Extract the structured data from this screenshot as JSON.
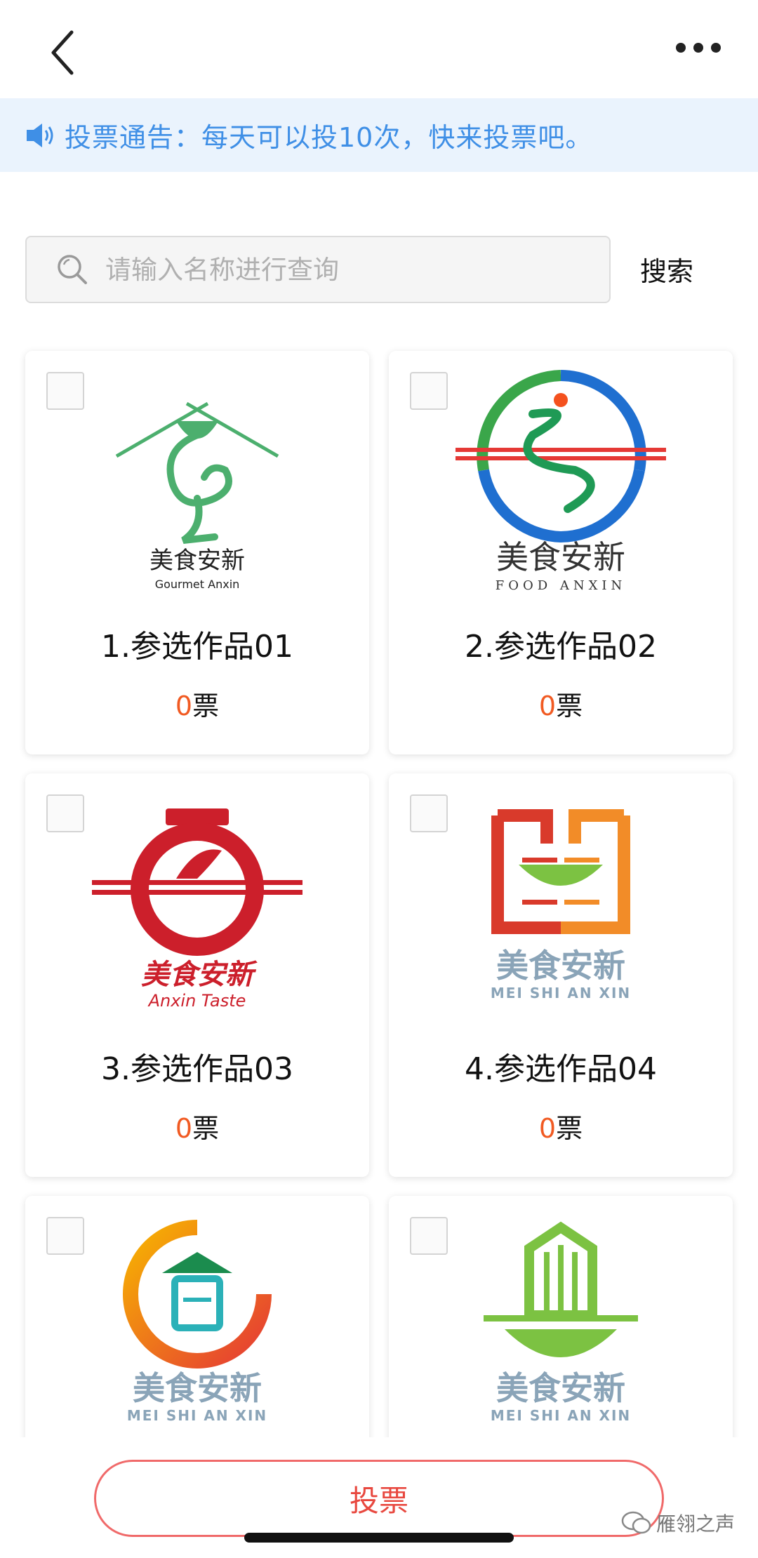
{
  "header": {
    "back_icon": "chevron-left-icon",
    "more_icon": "more-dots-icon"
  },
  "notice": {
    "icon": "speaker-icon",
    "text": "投票通告：每天可以投10次，快来投票吧。"
  },
  "search": {
    "placeholder": "请输入名称进行查询",
    "value": "",
    "button_label": "搜索"
  },
  "entries": [
    {
      "title": "1.参选作品01",
      "votes": "0",
      "unit": "票",
      "logo_text": "美食安新",
      "logo_sub": "Gourmet Anxin",
      "checked": false
    },
    {
      "title": "2.参选作品02",
      "votes": "0",
      "unit": "票",
      "logo_text": "美食安新",
      "logo_sub": "FOOD ANXIN",
      "checked": false
    },
    {
      "title": "3.参选作品03",
      "votes": "0",
      "unit": "票",
      "logo_text": "美食安新",
      "logo_sub": "Anxin Taste",
      "checked": false
    },
    {
      "title": "4.参选作品04",
      "votes": "0",
      "unit": "票",
      "logo_text": "美食安新",
      "logo_sub": "MEI SHI AN XIN",
      "checked": false
    },
    {
      "title": "",
      "votes": "",
      "unit": "",
      "logo_text": "美食安新",
      "logo_sub": "MEI SHI AN XIN",
      "checked": false
    },
    {
      "title": "",
      "votes": "",
      "unit": "",
      "logo_text": "美食安新",
      "logo_sub": "MEI SHI AN XIN",
      "checked": false
    }
  ],
  "vote_button_label": "投票",
  "watermark": "雁翎之声",
  "colors": {
    "accent_blue": "#3f8fe6",
    "notice_bg": "#eaf3fd",
    "vote_red": "#e8483f",
    "count_orange": "#f15a22"
  }
}
